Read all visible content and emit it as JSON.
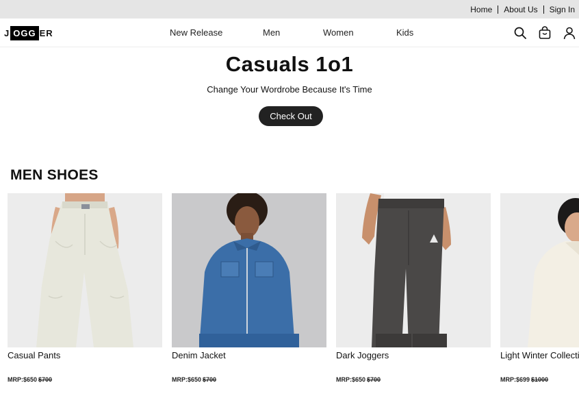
{
  "topbar": {
    "links": [
      "Home",
      "About Us",
      "Sign In"
    ]
  },
  "header": {
    "logo": {
      "pre": "J",
      "boxed": "OGG",
      "post": "ER"
    },
    "menu": [
      "New Release",
      "Men",
      "Women",
      "Kids"
    ],
    "icons": [
      "search-icon",
      "bag-icon",
      "user-icon"
    ]
  },
  "hero": {
    "title": "Casuals 1o1",
    "subtitle": "Change Your Wordrobe Because It's Time",
    "button": "Check Out"
  },
  "section": {
    "title": "MEN SHOES",
    "products": [
      {
        "name": "Casual Pants",
        "mrp": "MRP:$650",
        "old_price": "$700",
        "image": "cream-pants-photo"
      },
      {
        "name": "Denim Jacket",
        "mrp": "MRP:$650",
        "old_price": "$700",
        "image": "denim-jacket-photo"
      },
      {
        "name": "Dark Joggers",
        "mrp": "MRP:$650",
        "old_price": "$700",
        "image": "dark-joggers-photo"
      },
      {
        "name": "Light Winter Collection",
        "mrp": "MRP:$699",
        "old_price": "$1000",
        "image": "cream-sweater-photo"
      }
    ]
  },
  "colors": {
    "topbar_bg": "#e5e5e5",
    "button_bg": "#222222",
    "image_bg": "#ededed"
  }
}
